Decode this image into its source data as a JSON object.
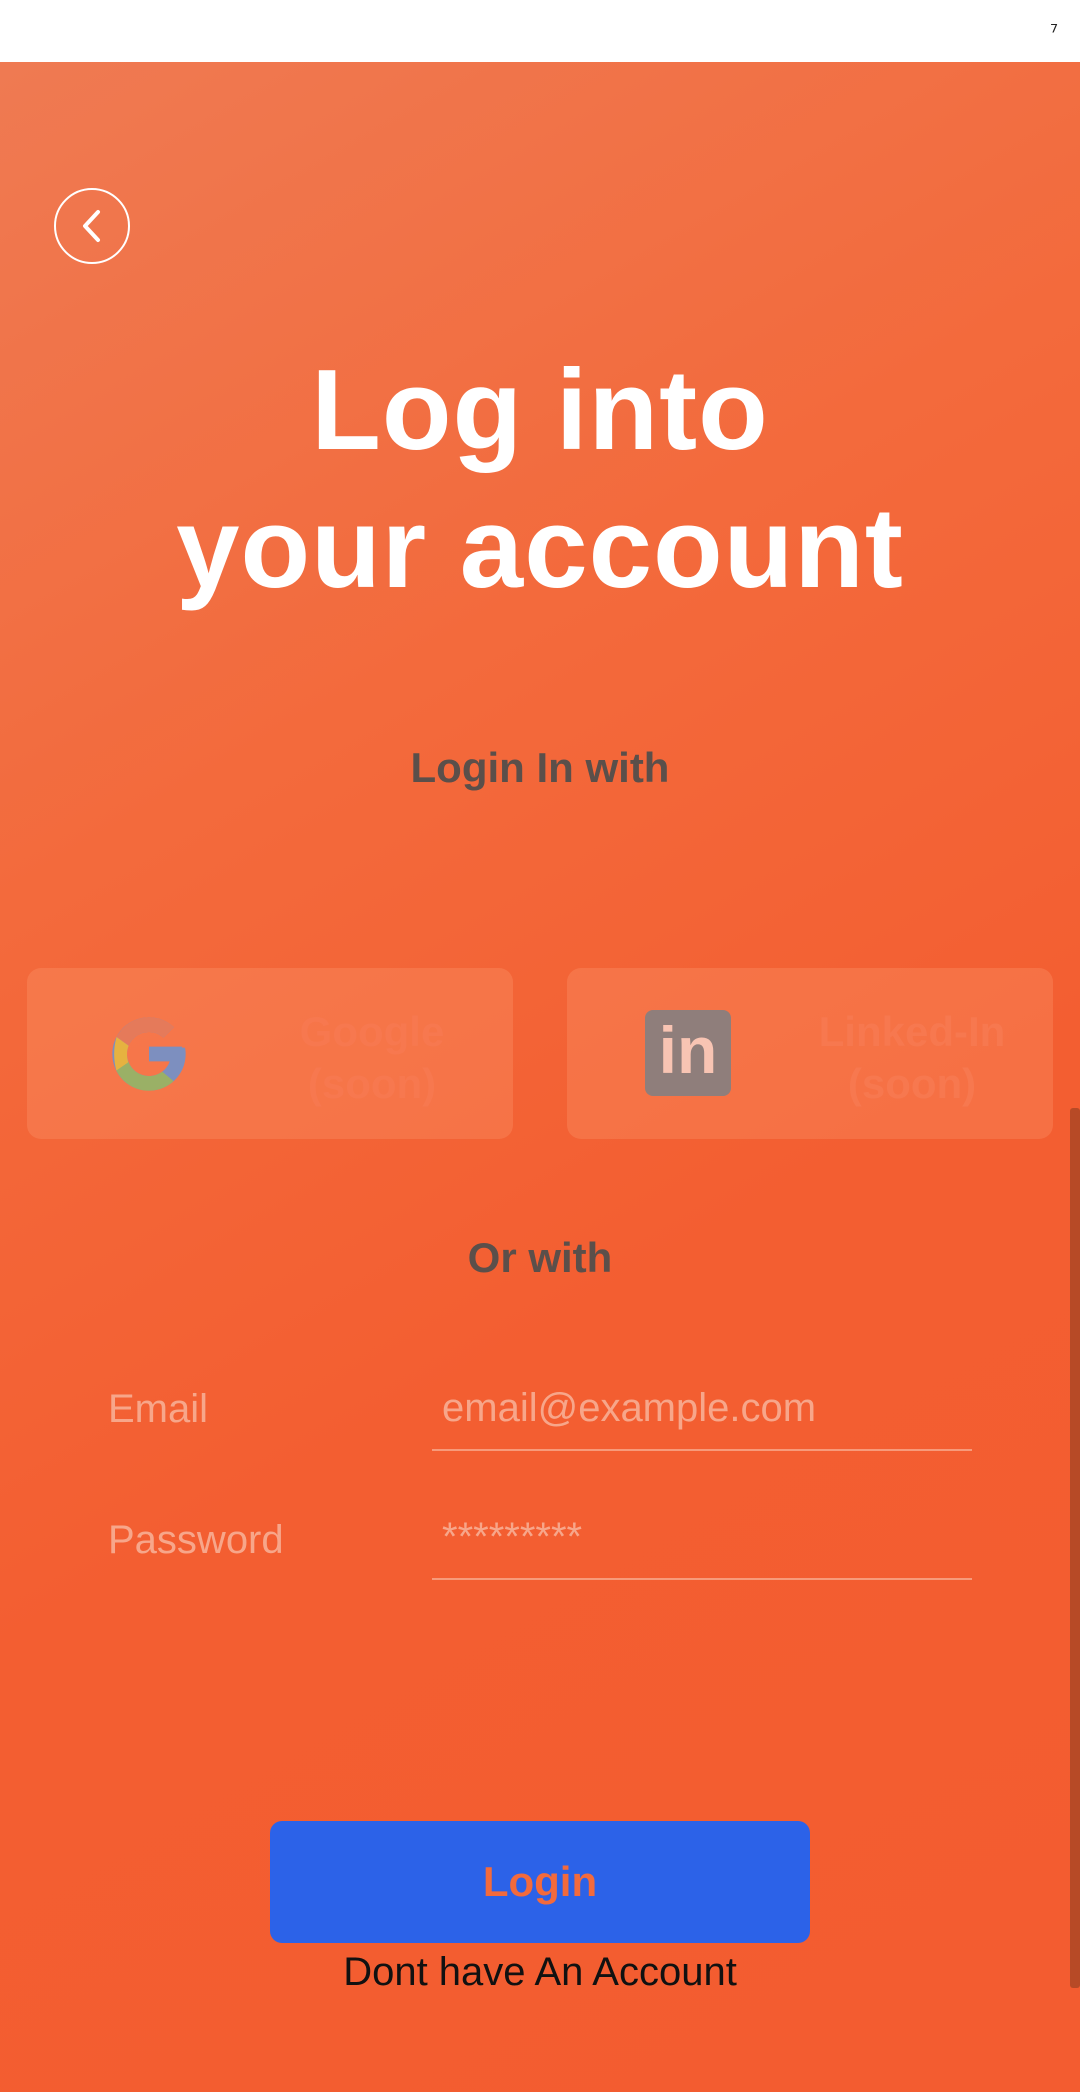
{
  "status_bar": {
    "glyph": "⁷"
  },
  "header": {
    "back_icon": "chevron-left-icon",
    "title_line1": "Log into",
    "title_line2": "your account"
  },
  "social": {
    "heading": "Login In with",
    "google": {
      "icon": "google-icon",
      "line1": "Google",
      "line2": "(soon)"
    },
    "linkedin": {
      "icon": "linkedin-icon",
      "glyph": "in",
      "line1": "Linked-In",
      "line2": "(soon)"
    }
  },
  "form": {
    "heading": "Or with",
    "email_label": "Email",
    "email_placeholder": "email@example.com",
    "password_label": "Password",
    "password_placeholder": "*********"
  },
  "actions": {
    "login_label": "Login",
    "signup_label": "Dont have An Account"
  },
  "colors": {
    "background": "#f35e31",
    "primary_button": "#2c62e8",
    "title_text": "#ffffff",
    "heading_text": "#5b4f4a"
  }
}
